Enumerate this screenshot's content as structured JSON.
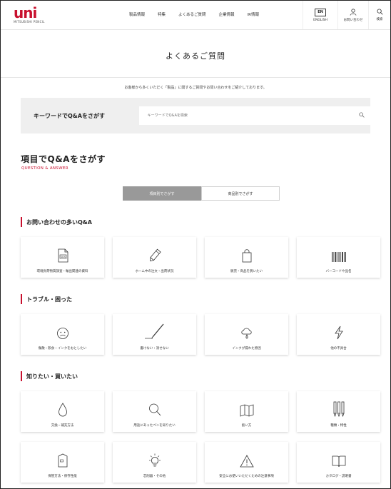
{
  "header": {
    "logo_text": "uni",
    "logo_sub": "MITSUBISHI PENCIL",
    "nav": [
      "製品情報",
      "特集",
      "よくあるご質問",
      "企業情報",
      "IR情報"
    ],
    "english_label": "ENGLISH",
    "english_box": "EN",
    "contact_label": "お問い合わせ",
    "search_label": "検索"
  },
  "page": {
    "title": "よくあるご質問",
    "intro": "お客様から多くいただく「製品」に関するご質問やお問い合わせをご紹介しております。"
  },
  "keyword": {
    "label": "キーワードでQ&Aをさがす",
    "placeholder": "キーワードでQ&Aを検索"
  },
  "by_item": {
    "title": "項目でQ&Aをさがす",
    "subtitle": "QUESTION & ANSWER",
    "toggle_active": "項目別でさがす",
    "toggle_inactive": "商品別でさがす"
  },
  "categories": [
    {
      "title": "お問い合わせの多いQ&A",
      "items": [
        {
          "label": "環境負荷物質調査・輸出関連の資料",
          "icon": "document-sds-icon"
        },
        {
          "label": "ホーム中の注文・出荷状況",
          "icon": "pencil-icon"
        },
        {
          "label": "販売・商品を買いたい",
          "icon": "shopping-bag-icon"
        },
        {
          "label": "バーコードや品名",
          "icon": "barcode-icon"
        }
      ]
    },
    {
      "title": "トラブル・困った",
      "items": [
        {
          "label": "傷散・飲食・インクをおとしたい",
          "icon": "face-worried-icon"
        },
        {
          "label": "書けない・消せない",
          "icon": "pen-writing-icon"
        },
        {
          "label": "インクが漏れた原因",
          "icon": "ink-leak-icon"
        },
        {
          "label": "他の不具合",
          "icon": "lightning-icon"
        }
      ]
    },
    {
      "title": "知りたい・買いたい",
      "items": [
        {
          "label": "交換・補充方法",
          "icon": "drop-icon"
        },
        {
          "label": "用途にあったペンを知りたい",
          "icon": "magnifier-icon"
        },
        {
          "label": "扱い方",
          "icon": "map-book-icon"
        },
        {
          "label": "種類・特性",
          "icon": "pens-icon"
        },
        {
          "label": "保管方法・保存性能",
          "icon": "storage-box-icon"
        },
        {
          "label": "芯削器・その他",
          "icon": "light-bulb-icon"
        },
        {
          "label": "安全にお使いいただくための注意事項",
          "icon": "warning-icon"
        },
        {
          "label": "カタログ・説明書",
          "icon": "open-book-icon"
        }
      ]
    }
  ]
}
